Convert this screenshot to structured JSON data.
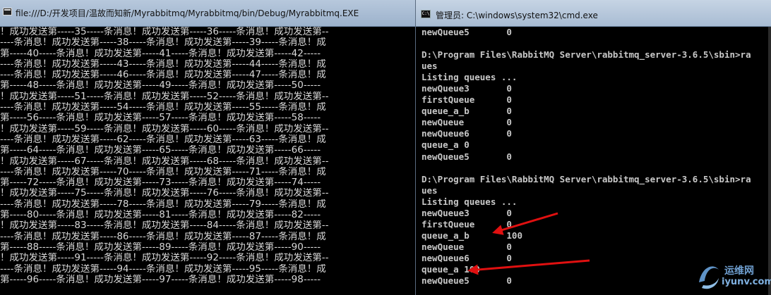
{
  "left_window": {
    "title": "file:///D:/开发项目/温故而知新/Myrabbitmq/Myrabbitmq/bin/Debug/Myrabbitmq.EXE",
    "lines": [
      "！成功发送第-----35-----条消息！成功发送第-----36-----条消息！成功发送第--",
      "----条消息！成功发送第-----38-----条消息！成功发送第-----39-----条消息！成",
      "第-----40-----条消息！成功发送第-----41-----条消息！成功发送第-----42-----",
      "----条消息！成功发送第-----43-----条消息！成功发送第-----44-----条消息！成",
      "----条消息！成功发送第-----46-----条消息！成功发送第-----47-----条消息！成",
      "第-----48-----条消息！成功发送第-----49-----条消息！成功发送第-----50-----",
      "！成功发送第-----51-----条消息！成功发送第-----52-----条消息！成功发送第--",
      "----条消息！成功发送第-----54-----条消息！成功发送第-----55-----条消息！成",
      "第-----56-----条消息！成功发送第-----57-----条消息！成功发送第-----58-----",
      "！成功发送第-----59-----条消息！成功发送第-----60-----条消息！成功发送第--",
      "----条消息！成功发送第-----62-----条消息！成功发送第-----63-----条消息！成",
      "第-----64-----条消息！成功发送第-----65-----条消息！成功发送第-----66-----",
      "！成功发送第-----67-----条消息！成功发送第-----68-----条消息！成功发送第--",
      "----条消息！成功发送第-----70-----条消息！成功发送第-----71-----条消息！成",
      "第-----72-----条消息！成功发送第-----73-----条消息！成功发送第-----74-----",
      "！成功发送第-----75-----条消息！成功发送第-----76-----条消息！成功发送第--",
      "----条消息！成功发送第-----78-----条消息！成功发送第-----79-----条消息！成",
      "第-----80-----条消息！成功发送第-----81-----条消息！成功发送第-----82-----",
      "！成功发送第-----83-----条消息！成功发送第-----84-----条消息！成功发送第--",
      "----条消息！成功发送第-----86-----条消息！成功发送第-----87-----条消息！成",
      "第-----88-----条消息！成功发送第-----89-----条消息！成功发送第-----90-----",
      "！成功发送第-----91-----条消息！成功发送第-----92-----条消息！成功发送第--",
      "----条消息！成功发送第-----94-----条消息！成功发送第-----95-----条消息！成",
      "第-----96-----条消息！成功发送第-----97-----条消息！成功发送第-----98-----"
    ]
  },
  "right_window": {
    "title": "管理员: C:\\windows\\system32\\cmd.exe",
    "lines": [
      "newQueue5       0",
      "",
      "D:\\Program Files\\RabbitMQ Server\\rabbitmq_server-3.6.5\\sbin>ra",
      "ues",
      "Listing queues ...",
      "newQueue3       0",
      "firstQueue      0",
      "queue_a_b       0",
      "newQueue        0",
      "newQueue6       0",
      "queue_a 0",
      "newQueue5       0",
      "",
      "D:\\Program Files\\RabbitMQ Server\\rabbitmq_server-3.6.5\\sbin>ra",
      "ues",
      "Listing queues ...",
      "newQueue3       0",
      "firstQueue      0",
      "queue_a_b       100",
      "newQueue        0",
      "newQueue6       0",
      "queue_a 100",
      "newQueue5       0"
    ]
  },
  "watermark": {
    "top": "运维网",
    "bottom": "iyunv.com"
  },
  "colors": {
    "console_text": "#d8d8d8",
    "cmd_text": "#c8c8c8",
    "arrow": "#e01010",
    "titlebar": "#a8bcd3"
  }
}
